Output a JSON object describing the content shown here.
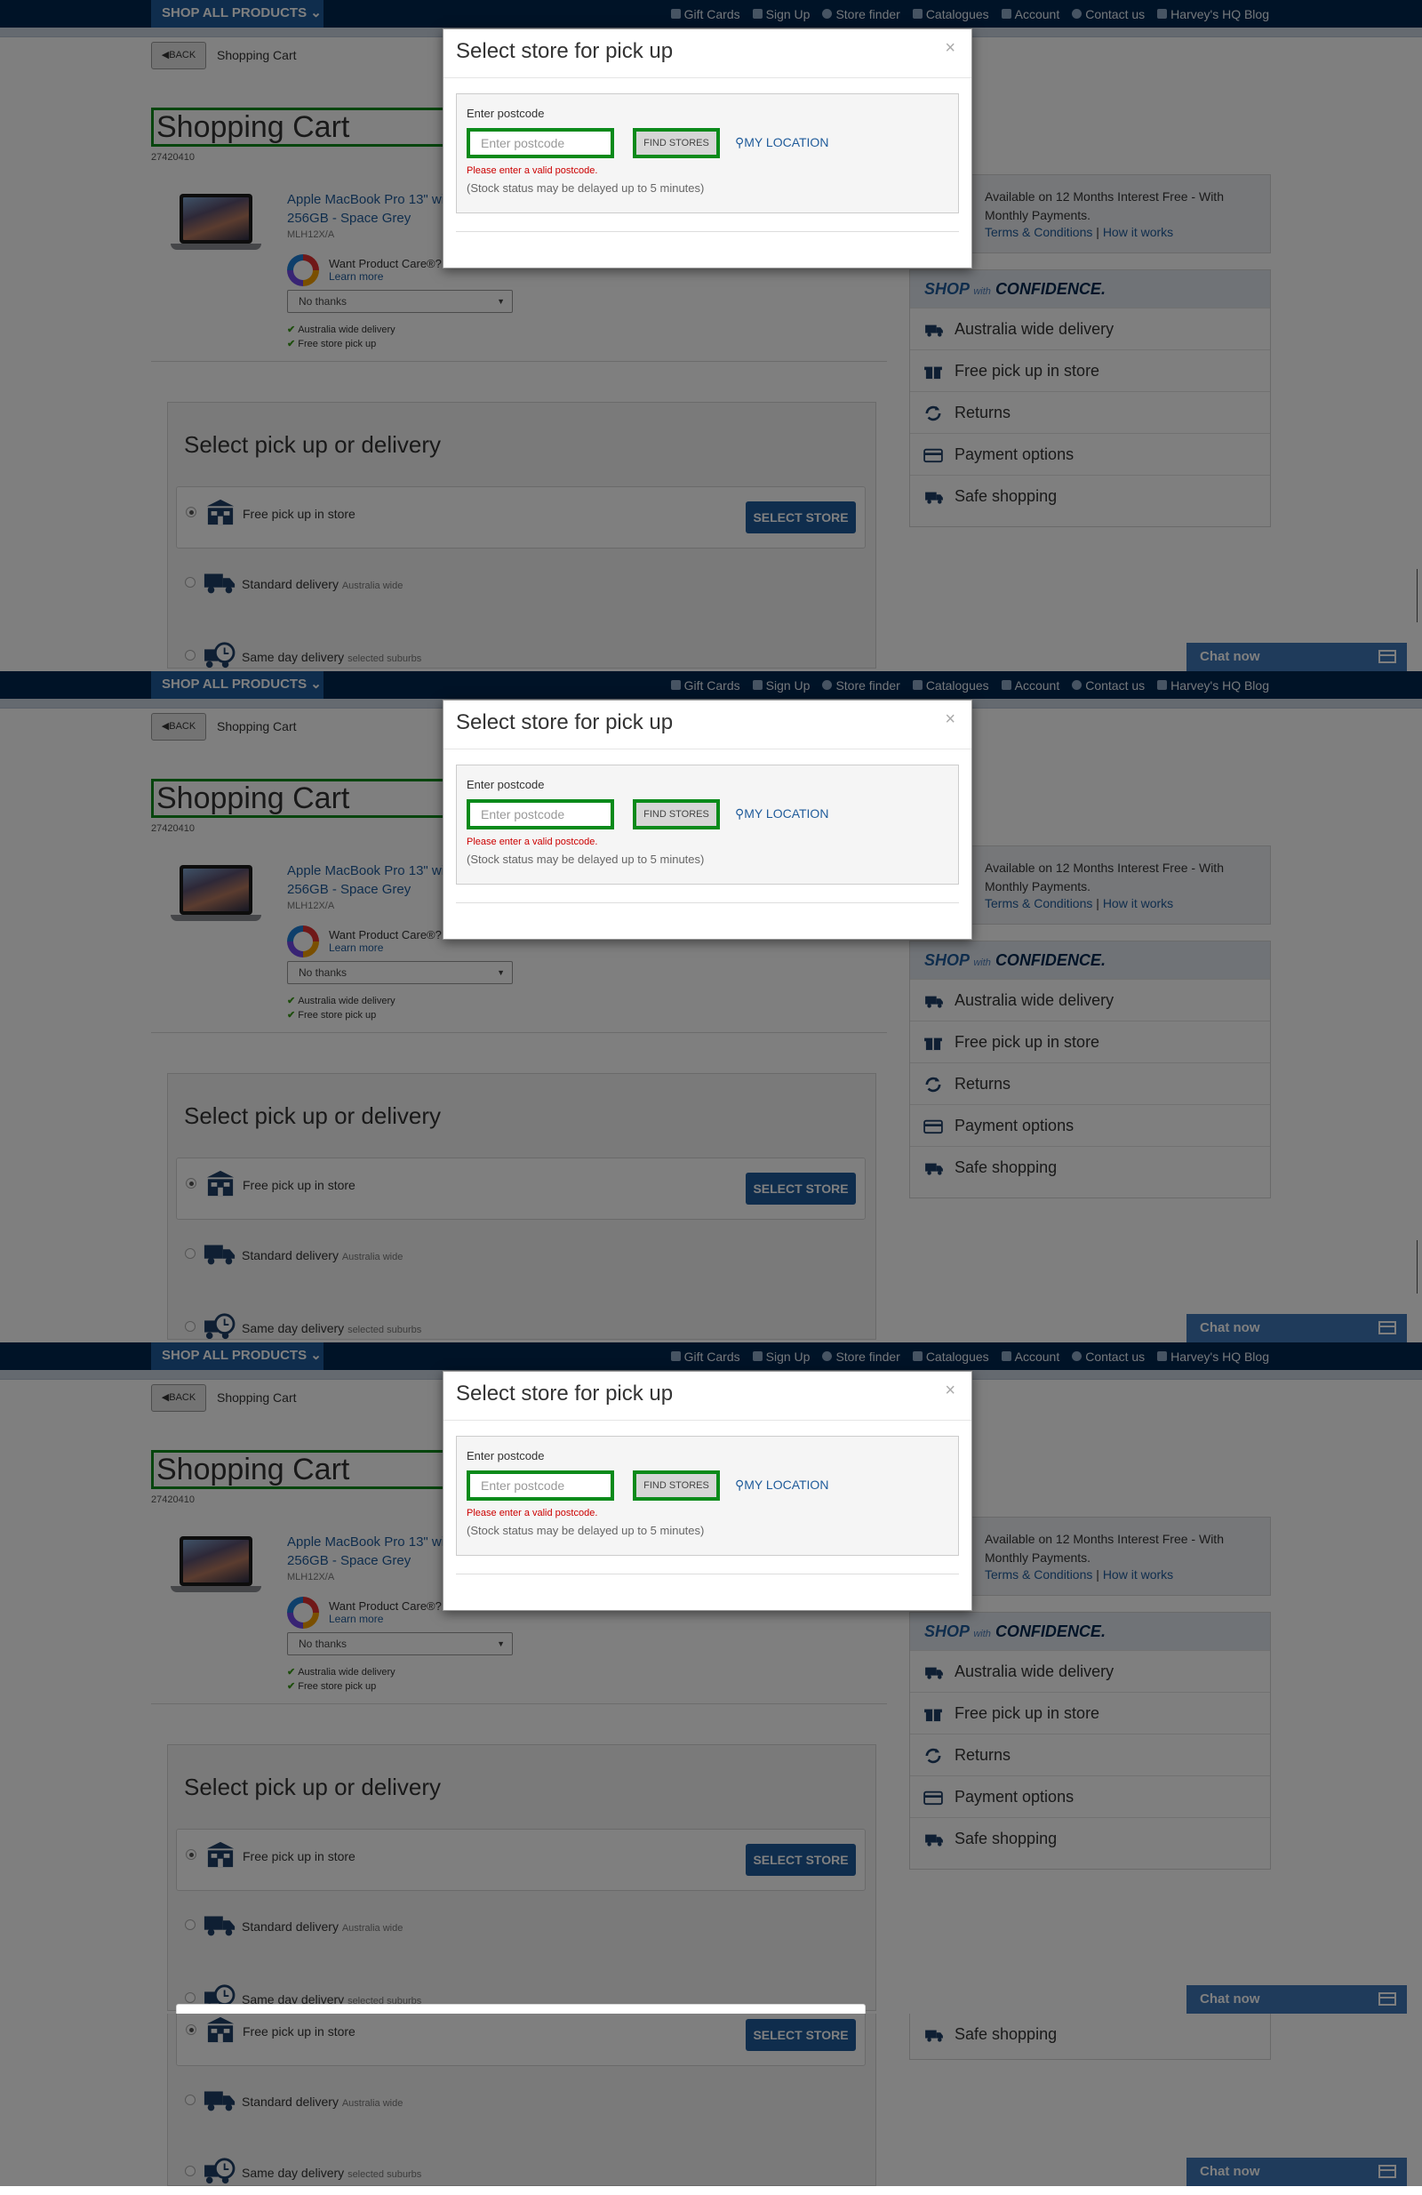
{
  "nav": {
    "shop_all": "SHOP ALL PRODUCTS",
    "links": [
      "Gift Cards",
      "Sign Up",
      "Store finder",
      "Catalogues",
      "Account",
      "Contact us",
      "Harvey's HQ Blog"
    ]
  },
  "breadcrumb": {
    "back": "BACK",
    "current": "Shopping Cart"
  },
  "cart": {
    "title": "Shopping Cart",
    "order_id": "27420410",
    "product": {
      "name": "Apple MacBook Pro 13\" with 256GB - Space Grey",
      "model": "MLH12X/A",
      "care_question": "Want Product Care®?",
      "care_link": "Learn more",
      "care_select": "No thanks",
      "features": [
        "Australia wide delivery",
        "Free store pick up"
      ]
    }
  },
  "delivery": {
    "title": "Select pick up or delivery",
    "options": [
      {
        "label": "Free pick up in store",
        "note": "",
        "selected": true,
        "button": "SELECT STORE"
      },
      {
        "label": "Standard delivery",
        "note": "Australia wide",
        "selected": false
      },
      {
        "label": "Same day delivery",
        "note": "selected suburbs",
        "selected": false
      }
    ]
  },
  "finance": {
    "text": "Available on 12 Months Interest Free - With Monthly Payments.",
    "terms": "Terms & Conditions",
    "separator": "|",
    "how": "How it works"
  },
  "confidence": {
    "head_shop": "SHOP",
    "head_with": "with",
    "head_conf": "CONFIDENCE.",
    "items": [
      {
        "label": "Australia wide delivery",
        "icon": "truck-icon"
      },
      {
        "label": "Free pick up in store",
        "icon": "gift-icon"
      },
      {
        "label": "Returns",
        "icon": "refresh-icon"
      },
      {
        "label": "Payment options",
        "icon": "credit-card-icon"
      },
      {
        "label": "Safe shopping",
        "icon": "truck-icon"
      }
    ]
  },
  "chat": {
    "label": "Chat now"
  },
  "modal": {
    "title": "Select store for pick up",
    "close": "×",
    "postcode_label": "Enter postcode",
    "postcode_value": "",
    "postcode_placeholder": "Enter postcode",
    "find_button": "FIND STORES",
    "my_location": "MY LOCATION",
    "error": "Please enter a valid postcode.",
    "stock_note": "(Stock status may be delayed up to 5 minutes)"
  },
  "colors": {
    "nav": "#00264f",
    "brand_blue": "#1f5b9a",
    "focus_green": "#0a8a1a",
    "error_red": "#cc0000"
  }
}
